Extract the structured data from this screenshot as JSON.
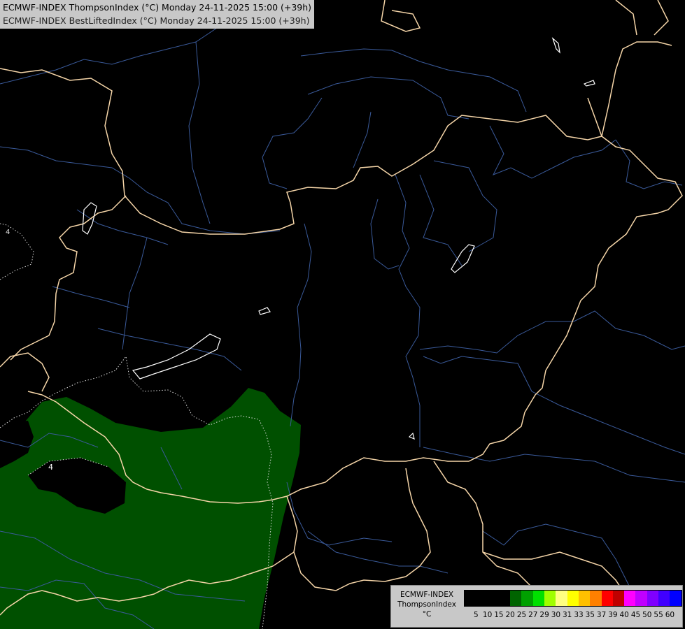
{
  "header": {
    "line1": "ECMWF-INDEX ThompsonIndex (°C) Monday 24-11-2025 15:00 (+39h)",
    "line2": "ECMWF-INDEX BestLiftedIndex (°C) Monday 24-11-2025 15:00 (+39h)"
  },
  "map": {
    "contour_labels": [
      "4",
      "4"
    ],
    "colors": {
      "background": "#000000",
      "thompson_fill": "#005000",
      "borders": "#f5d5a8",
      "rivers": "#3a5a9a",
      "lakes": "#ffffff",
      "contours": "#dddddd"
    }
  },
  "legend": {
    "title_lines": [
      "ECMWF-INDEX",
      "ThompsonIndex",
      "°C"
    ],
    "colors": [
      "#000000",
      "#000000",
      "#000000",
      "#000000",
      "#006400",
      "#00a000",
      "#00e000",
      "#a0ff00",
      "#ffff80",
      "#ffff00",
      "#ffc000",
      "#ff8000",
      "#ff0000",
      "#c00000",
      "#ff00ff",
      "#c000ff",
      "#8000ff",
      "#4000ff",
      "#0000ff"
    ],
    "ticks": [
      "5",
      "10",
      "15",
      "20",
      "25",
      "27",
      "29",
      "30",
      "31",
      "33",
      "35",
      "37",
      "39",
      "40",
      "45",
      "50",
      "55",
      "60"
    ]
  }
}
